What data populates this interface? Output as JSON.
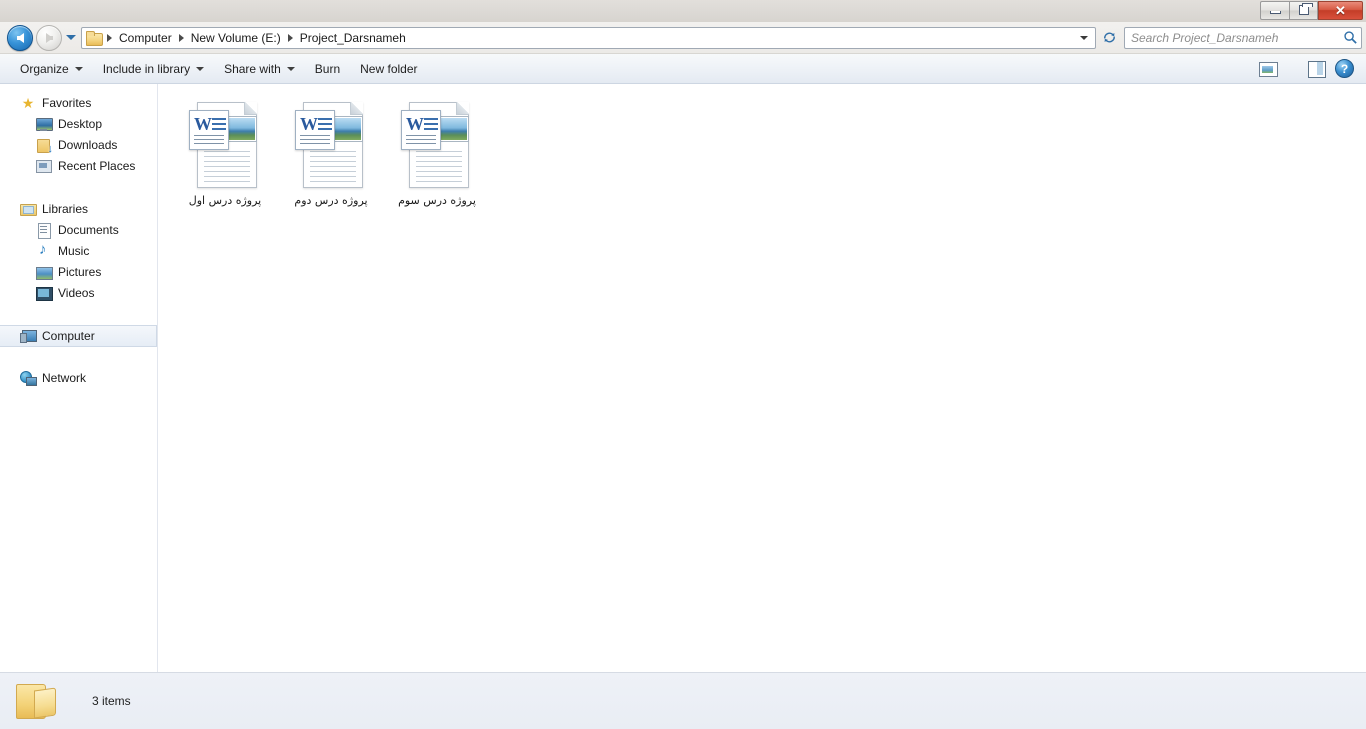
{
  "window": {
    "controls": {
      "minimize_label": "Minimize",
      "maximize_label": "Restore",
      "close_label": "✕"
    }
  },
  "navbar": {
    "back_label": "Back",
    "forward_label": "Forward",
    "history_label": "Recent pages",
    "breadcrumbs": [
      {
        "label": "Computer"
      },
      {
        "label": "New Volume (E:)"
      },
      {
        "label": "Project_Darsnameh"
      }
    ],
    "address_dropdown_label": "Previous locations",
    "refresh_label": "Refresh",
    "search": {
      "placeholder": "Search Project_Darsnameh",
      "value": ""
    }
  },
  "commandbar": {
    "items": [
      {
        "label": "Organize",
        "has_dropdown": true
      },
      {
        "label": "Include in library",
        "has_dropdown": true
      },
      {
        "label": "Share with",
        "has_dropdown": true
      },
      {
        "label": "Burn",
        "has_dropdown": false
      },
      {
        "label": "New folder",
        "has_dropdown": false
      }
    ],
    "change_view_label": "Change your view",
    "view_dropdown_label": "More options",
    "preview_pane_label": "Show the preview pane",
    "help_label": "?"
  },
  "sidebar": {
    "groups": [
      {
        "header": {
          "label": "Favorites",
          "icon": "star-icon"
        },
        "items": [
          {
            "label": "Desktop",
            "icon": "desktop-icon"
          },
          {
            "label": "Downloads",
            "icon": "downloads-icon"
          },
          {
            "label": "Recent Places",
            "icon": "recent-places-icon"
          }
        ]
      },
      {
        "header": {
          "label": "Libraries",
          "icon": "libraries-icon"
        },
        "items": [
          {
            "label": "Documents",
            "icon": "documents-icon"
          },
          {
            "label": "Music",
            "icon": "music-icon"
          },
          {
            "label": "Pictures",
            "icon": "pictures-icon"
          },
          {
            "label": "Videos",
            "icon": "videos-icon"
          }
        ]
      },
      {
        "header": {
          "label": "Computer",
          "icon": "computer-icon",
          "selected": true
        },
        "items": []
      },
      {
        "header": {
          "label": "Network",
          "icon": "network-icon"
        },
        "items": []
      }
    ]
  },
  "content": {
    "files": [
      {
        "name": "پروژه درس اول",
        "icon": "word-document-icon"
      },
      {
        "name": "پروژه درس دوم",
        "icon": "word-document-icon"
      },
      {
        "name": "پروژه درس سوم",
        "icon": "word-document-icon"
      }
    ]
  },
  "statusbar": {
    "folder_icon": "folder-icon",
    "item_count_text": "3 items"
  },
  "colors": {
    "titlebar": "#dcd9d5",
    "close_button": "#c33d28",
    "command_bar": "#eef2f7",
    "selection": "#e6edf6",
    "status_bar": "#eef1f7",
    "accent_blue": "#2f6fa8"
  }
}
